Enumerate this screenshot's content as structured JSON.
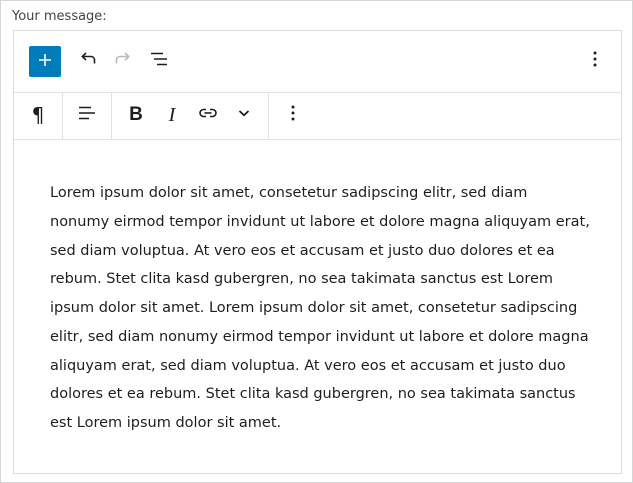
{
  "form": {
    "label": "Your message:"
  },
  "toolbar": {
    "add_icon": "plus-icon",
    "undo_icon": "undo-icon",
    "redo_icon": "redo-icon",
    "outline_icon": "list-view-icon",
    "options_icon": "vertical-ellipsis-icon"
  },
  "block_toolbar": {
    "paragraph_glyph": "¶",
    "bold_glyph": "B",
    "italic_glyph": "I",
    "align_icon": "align-left-icon",
    "link_icon": "link-icon",
    "more_formats_icon": "chevron-down-icon",
    "block_options_icon": "vertical-ellipsis-icon"
  },
  "content": {
    "paragraph": "Lorem ipsum dolor sit amet, consetetur sadipscing elitr, sed diam nonumy eirmod tempor invidunt ut labore et dolore magna aliquyam erat, sed diam voluptua. At vero eos et accusam et justo duo dolores et ea rebum. Stet clita kasd gubergren, no sea takimata sanctus est Lorem ipsum dolor sit amet. Lorem ipsum dolor sit amet, consetetur sadipscing elitr, sed diam nonumy eirmod tempor invidunt ut labore et dolore magna aliquyam erat, sed diam voluptua. At vero eos et accusam et justo duo dolores et ea rebum. Stet clita kasd gubergren, no sea takimata sanctus est Lorem ipsum dolor sit amet."
  },
  "colors": {
    "accent": "#007cba",
    "text": "#1e1e1e",
    "border": "#dcdcdc",
    "disabled": "#b8b8b8"
  }
}
